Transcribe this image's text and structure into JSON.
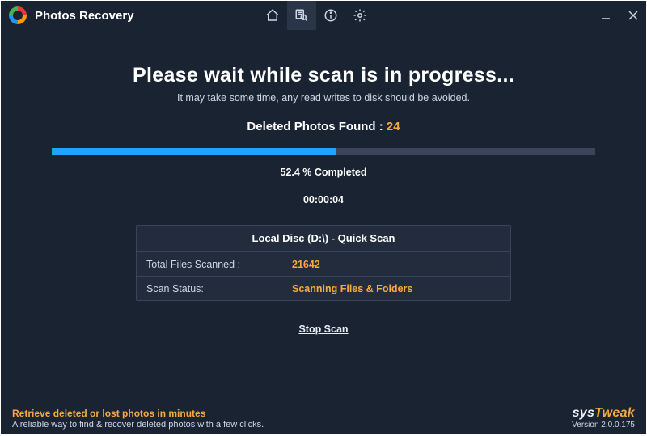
{
  "window": {
    "title": "Photos Recovery"
  },
  "scan": {
    "headline": "Please wait while scan is in progress...",
    "subhead": "It may take some time, any read writes to disk should be avoided.",
    "found_label": "Deleted Photos Found : ",
    "found_count": "24",
    "progress_percent": 52.4,
    "percent_text": "52.4 % Completed",
    "elapsed": "00:00:04",
    "stop_label": "Stop Scan"
  },
  "details": {
    "panel_title": "Local Disc (D:\\) - Quick Scan",
    "rows": [
      {
        "label": "Total Files Scanned :",
        "value": "21642"
      },
      {
        "label": "Scan Status:",
        "value": "Scanning Files & Folders"
      }
    ]
  },
  "footer": {
    "tagline": "Retrieve deleted or lost photos in minutes",
    "tagdesc": "A reliable way to find & recover deleted photos with a few clicks.",
    "brand_a": "sys",
    "brand_b": "Tweak",
    "version": "Version 2.0.0.175"
  },
  "colors": {
    "accent": "#f7a93b",
    "progress": "#1aa6ff"
  }
}
